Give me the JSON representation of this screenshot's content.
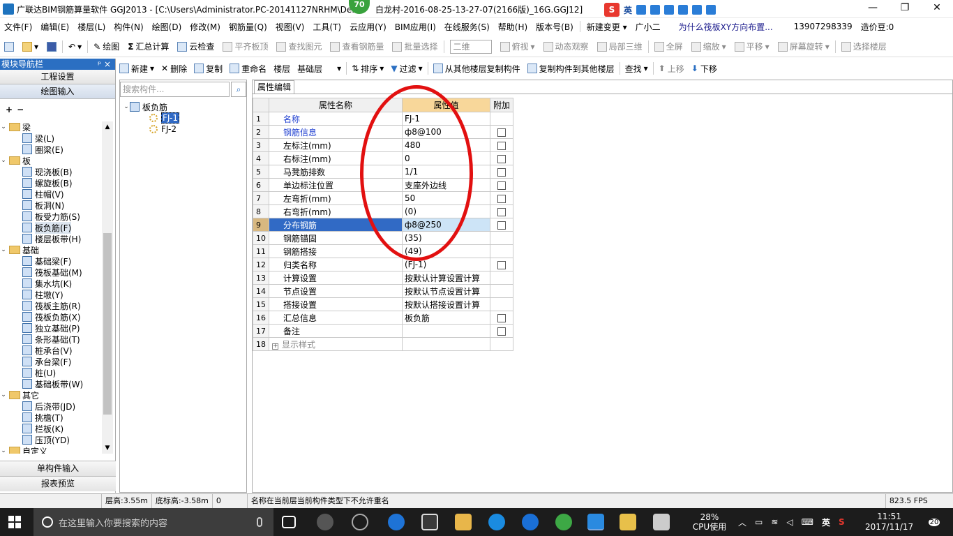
{
  "window": {
    "title": "广联达BIM钢筋算量软件 GGJ2013 - [C:\\Users\\Administrator.PC-20141127NRHM\\De...",
    "title_right": "白龙村-2016-08-25-13-27-07(2166版)_16G.GGJ12]",
    "badge": "70",
    "ime_label": "英",
    "minimize": "—",
    "restore": "❐",
    "close": "✕"
  },
  "menu": [
    "文件(F)",
    "编辑(E)",
    "楼层(L)",
    "构件(N)",
    "绘图(D)",
    "修改(M)",
    "钢筋量(Q)",
    "视图(V)",
    "工具(T)",
    "云应用(Y)",
    "BIM应用(I)",
    "在线服务(S)",
    "帮助(H)",
    "版本号(B)"
  ],
  "menu_extra": {
    "new_change": "新建变更",
    "assistant": "广小二",
    "question": "为什么筏板XY方向布置...",
    "phone": "13907298339",
    "price": "造价豆:0"
  },
  "toolbar1": {
    "draw": "绘图",
    "sum": "汇总计算",
    "cloud_check": "云检查",
    "flush": "平齐板顶",
    "find_elem": "查找图元",
    "view_rebar": "查看钢筋量",
    "batch_select": "批量选择",
    "view_mode": "二维",
    "top_view": "俯视",
    "dynamic": "动态观察",
    "local3d": "局部三维",
    "fullscreen": "全屏",
    "zoom": "缩放",
    "pan": "平移",
    "rotate": "屏幕旋转",
    "select_floor": "选择楼层"
  },
  "nav": {
    "header": "模块导航栏",
    "pin": "ᵖ ×",
    "project_settings": "工程设置",
    "draw_input": "绘图输入",
    "single_input": "单构件输入",
    "report_preview": "报表预览",
    "tree": [
      {
        "type": "group",
        "label": "梁"
      },
      {
        "type": "item",
        "label": "梁(L)"
      },
      {
        "type": "item",
        "label": "圈梁(E)"
      },
      {
        "type": "group",
        "label": "板"
      },
      {
        "type": "item",
        "label": "现浇板(B)"
      },
      {
        "type": "item",
        "label": "螺旋板(B)"
      },
      {
        "type": "item",
        "label": "柱帽(V)"
      },
      {
        "type": "item",
        "label": "板洞(N)"
      },
      {
        "type": "item",
        "label": "板受力筋(S)"
      },
      {
        "type": "item",
        "label": "板负筋(F)",
        "selected": true
      },
      {
        "type": "item",
        "label": "楼层板带(H)"
      },
      {
        "type": "group",
        "label": "基础"
      },
      {
        "type": "item",
        "label": "基础梁(F)"
      },
      {
        "type": "item",
        "label": "筏板基础(M)"
      },
      {
        "type": "item",
        "label": "集水坑(K)"
      },
      {
        "type": "item",
        "label": "柱墩(Y)"
      },
      {
        "type": "item",
        "label": "筏板主筋(R)"
      },
      {
        "type": "item",
        "label": "筏板负筋(X)"
      },
      {
        "type": "item",
        "label": "独立基础(P)"
      },
      {
        "type": "item",
        "label": "条形基础(T)"
      },
      {
        "type": "item",
        "label": "桩承台(V)"
      },
      {
        "type": "item",
        "label": "承台梁(F)"
      },
      {
        "type": "item",
        "label": "桩(U)"
      },
      {
        "type": "item",
        "label": "基础板带(W)"
      },
      {
        "type": "group",
        "label": "其它"
      },
      {
        "type": "item",
        "label": "后浇带(JD)"
      },
      {
        "type": "item",
        "label": "挑檐(T)"
      },
      {
        "type": "item",
        "label": "栏板(K)"
      },
      {
        "type": "item",
        "label": "压顶(YD)"
      },
      {
        "type": "group",
        "label": "自定义"
      }
    ]
  },
  "toolbar2": {
    "new": "新建",
    "delete": "删除",
    "copy": "复制",
    "rename": "重命名",
    "floor_label": "楼层",
    "floor_value": "基础层",
    "sort": "排序",
    "filter": "过滤",
    "copy_from": "从其他楼层复制构件",
    "copy_to": "复制构件到其他楼层",
    "find": "查找",
    "move_up": "上移",
    "move_down": "下移"
  },
  "components": {
    "search_placeholder": "搜索构件...",
    "root": "板负筋",
    "items": [
      "FJ-1",
      "FJ-2"
    ]
  },
  "properties": {
    "tab": "属性编辑",
    "headers": {
      "name": "属性名称",
      "value": "属性值",
      "extra": "附加"
    },
    "rows": [
      {
        "n": "1",
        "name": "名称",
        "value": "FJ-1",
        "blue": true,
        "check": false
      },
      {
        "n": "2",
        "name": "钢筋信息",
        "value": "ф8@100",
        "blue": true,
        "check": true
      },
      {
        "n": "3",
        "name": "左标注(mm)",
        "value": "480",
        "check": true
      },
      {
        "n": "4",
        "name": "右标注(mm)",
        "value": "0",
        "check": true
      },
      {
        "n": "5",
        "name": "马凳筋排数",
        "value": "1/1",
        "check": true
      },
      {
        "n": "6",
        "name": "单边标注位置",
        "value": "支座外边线",
        "check": true
      },
      {
        "n": "7",
        "name": "左弯折(mm)",
        "value": "50",
        "check": true
      },
      {
        "n": "8",
        "name": "右弯折(mm)",
        "value": "(0)",
        "check": true
      },
      {
        "n": "9",
        "name": "分布钢筋",
        "value": "ф8@250",
        "check": true,
        "selected": true
      },
      {
        "n": "10",
        "name": "钢筋锚固",
        "value": "(35)",
        "check": false
      },
      {
        "n": "11",
        "name": "钢筋搭接",
        "value": "(49)",
        "check": false
      },
      {
        "n": "12",
        "name": "归类名称",
        "value": "(FJ-1)",
        "check": true
      },
      {
        "n": "13",
        "name": "计算设置",
        "value": "按默认计算设置计算",
        "check": false
      },
      {
        "n": "14",
        "name": "节点设置",
        "value": "按默认节点设置计算",
        "check": false
      },
      {
        "n": "15",
        "name": "搭接设置",
        "value": "按默认搭接设置计算",
        "check": false
      },
      {
        "n": "16",
        "name": "汇总信息",
        "value": "板负筋",
        "check": true
      },
      {
        "n": "17",
        "name": "备注",
        "value": "",
        "check": true
      },
      {
        "n": "18",
        "name": "显示样式",
        "value": "",
        "check": false,
        "expand": true
      }
    ]
  },
  "status": {
    "floor_height": "层高:3.55m",
    "base_height": "底标高:-3.58m",
    "zero": "0",
    "message": "名称在当前层当前构件类型下不允许重名",
    "fps": "823.5 FPS"
  },
  "taskbar": {
    "search_placeholder": "在这里输入你要搜索的内容",
    "cpu_pct": "28%",
    "cpu_label": "CPU使用",
    "ime": "英",
    "time": "11:51",
    "date": "2017/11/17",
    "notif": "20"
  }
}
